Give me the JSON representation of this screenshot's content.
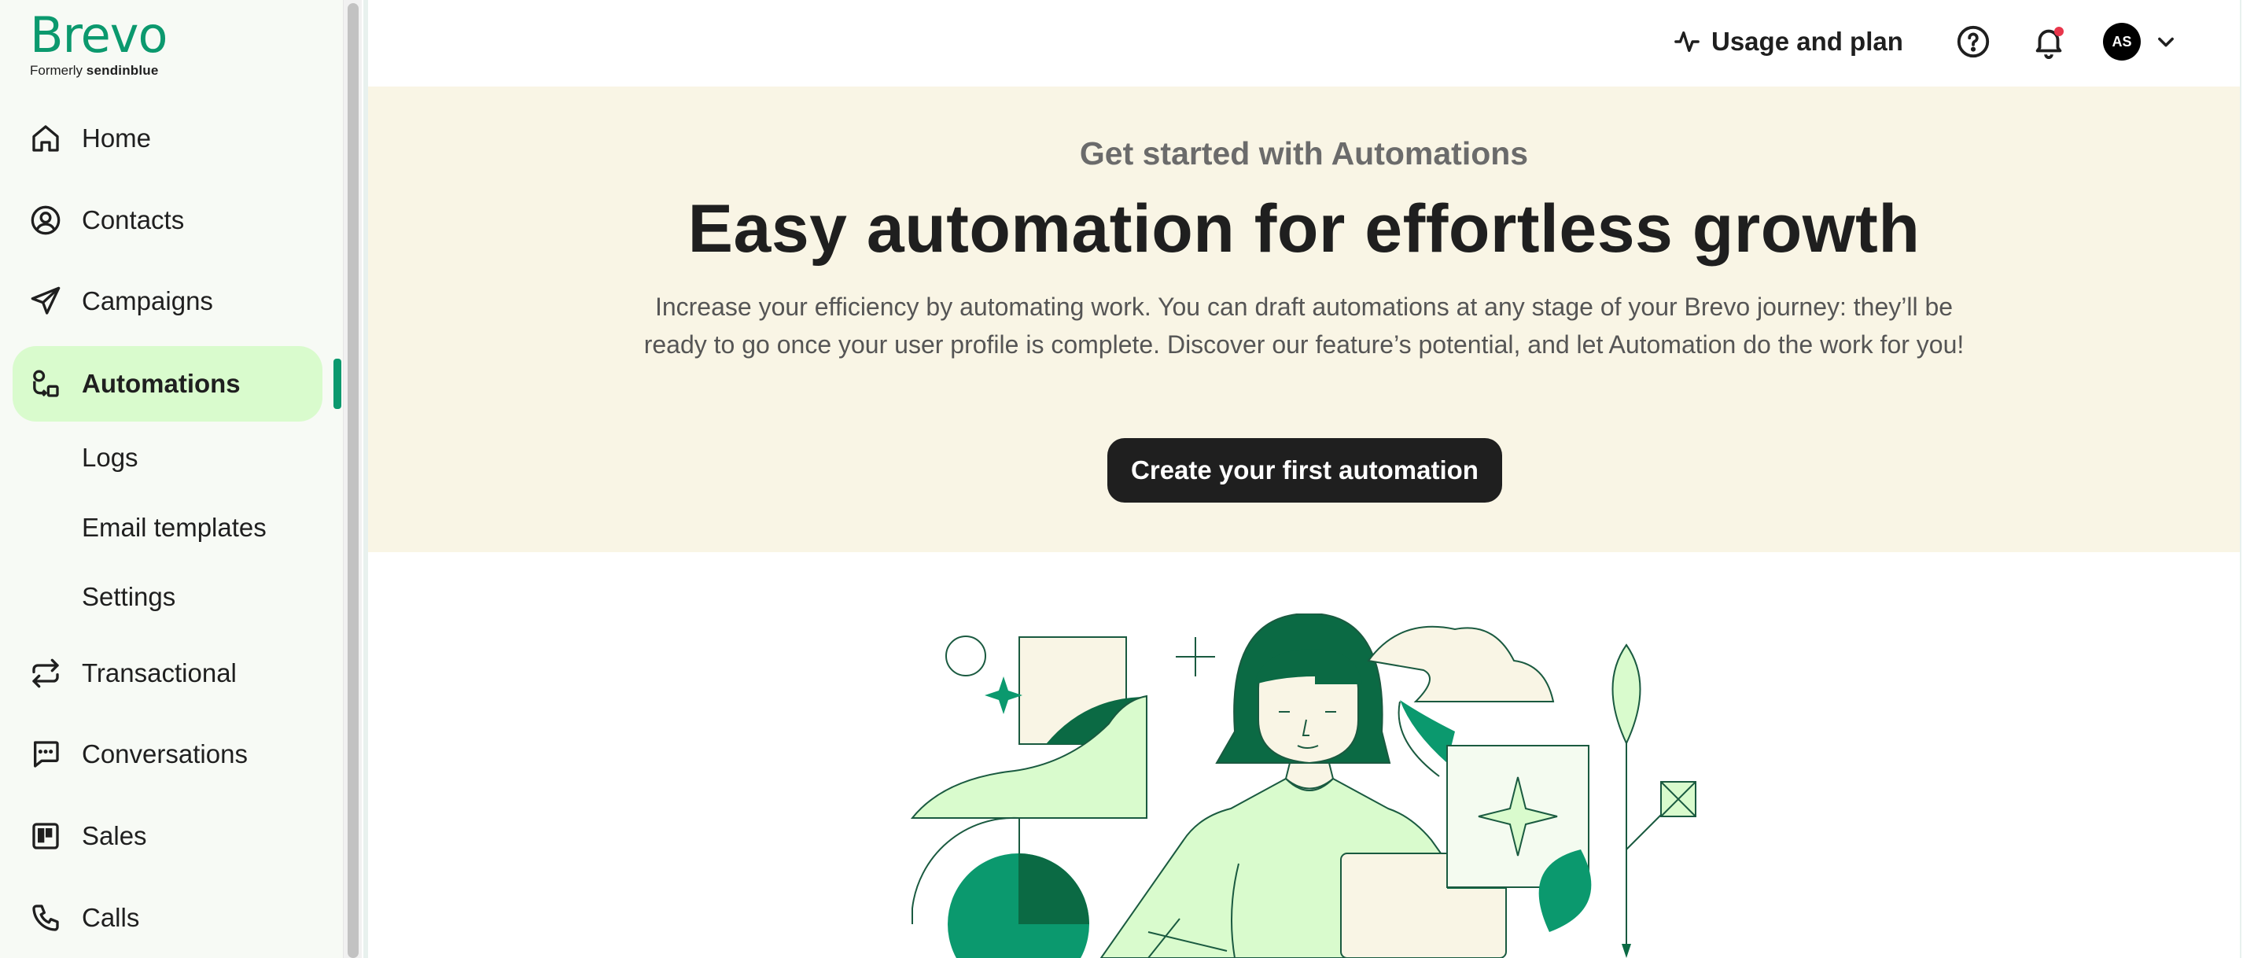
{
  "brand": {
    "name": "Brevo",
    "formerly_prefix": "Formerly",
    "formerly_name": "sendinblue",
    "accent_color": "#0b996e",
    "active_bg": "#d9fbcd"
  },
  "sidebar": {
    "items": [
      {
        "label": "Home",
        "icon": "home-icon"
      },
      {
        "label": "Contacts",
        "icon": "contacts-icon"
      },
      {
        "label": "Campaigns",
        "icon": "send-icon"
      },
      {
        "label": "Automations",
        "icon": "automation-icon",
        "active": true
      },
      {
        "label": "Transactional",
        "icon": "transactional-icon"
      },
      {
        "label": "Conversations",
        "icon": "chat-icon"
      },
      {
        "label": "Sales",
        "icon": "sales-icon"
      },
      {
        "label": "Calls",
        "icon": "phone-icon"
      }
    ],
    "sub_items": [
      "Logs",
      "Email templates",
      "Settings"
    ]
  },
  "topbar": {
    "usage_label": "Usage and plan",
    "usage_icon": "activity-icon",
    "help_icon": "help-icon",
    "notifications_icon": "bell-icon",
    "avatar_initials": "AS",
    "account_menu_icon": "chevron-down-icon"
  },
  "hero": {
    "eyebrow": "Get started with Automations",
    "headline": "Easy automation for effortless growth",
    "description": "Increase your efficiency by automating work. You can draft automations at any stage of your Brevo journey: they’ll be ready to go once your user profile is complete. Discover our feature’s potential, and let Automation do the work for you!",
    "cta_label": "Create your first automation",
    "background": "#f9f5e5"
  }
}
